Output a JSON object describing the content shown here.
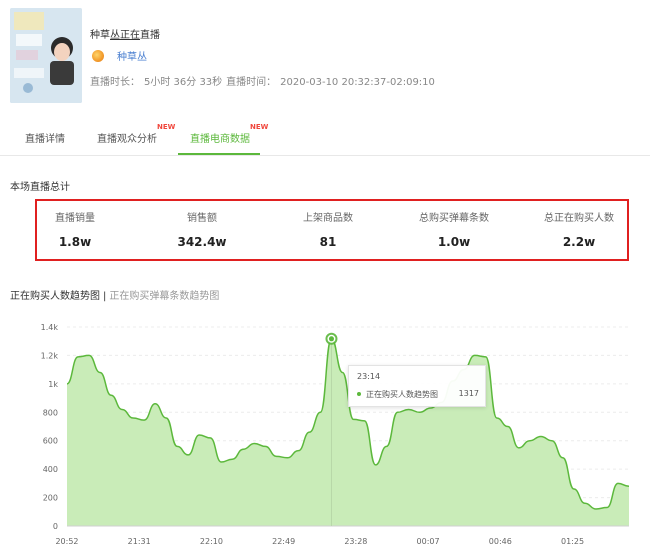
{
  "header": {
    "title_prefix": "种草",
    "title_underlined": "丛正在",
    "title_suffix": "直播",
    "anchor_name": "种草丛",
    "duration_label": "直播时长：",
    "duration_value": "5小时 36分 33秒",
    "time_label": "直播时间：",
    "time_value": "2020-03-10 20:32:37-02:09:10"
  },
  "tabs": [
    {
      "label": "直播详情",
      "new": ""
    },
    {
      "label": "直播观众分析",
      "new": "NEW"
    },
    {
      "label": "直播电商数据",
      "new": "NEW",
      "active": true
    }
  ],
  "summary": {
    "title": "本场直播总计",
    "stats": [
      {
        "label": "直播销量",
        "value": "1.8w"
      },
      {
        "label": "销售额",
        "value": "342.4w"
      },
      {
        "label": "上架商品数",
        "value": "81"
      },
      {
        "label": "总购买弹幕条数",
        "value": "1.0w"
      },
      {
        "label": "总正在购买人数",
        "value": "2.2w"
      }
    ]
  },
  "chart_tabs": {
    "active": "正在购买人数趋势图",
    "separator": "|",
    "inactive": "正在购买弹幕条数趋势图"
  },
  "tooltip": {
    "time": "23:14",
    "series": "正在购买人数趋势图",
    "value": "1317"
  },
  "colors": {
    "accent": "#5cb83c",
    "area_fill": "#c9ecb8",
    "highlight_border": "#e02020",
    "new_badge": "#f0473d"
  },
  "chart_data": {
    "type": "area",
    "title": "正在购买人数趋势图",
    "xlabel": "",
    "ylabel": "",
    "ylim": [
      0,
      1400
    ],
    "yticks": [
      0,
      200,
      400,
      600,
      800,
      1000,
      1200,
      1400
    ],
    "ytick_labels": [
      "0",
      "200",
      "400",
      "600",
      "800",
      "1k",
      "1.2k",
      "1.4k"
    ],
    "xtick_labels": [
      "20:52",
      "21:31",
      "22:10",
      "22:49",
      "23:28",
      "00:07",
      "00:46",
      "01:25"
    ],
    "grid": true,
    "x": [
      "20:52",
      "20:58",
      "21:05",
      "21:10",
      "21:17",
      "21:24",
      "21:31",
      "21:37",
      "21:43",
      "21:49",
      "21:52",
      "21:56",
      "22:02",
      "22:08",
      "22:13",
      "22:20",
      "22:28",
      "22:35",
      "22:42",
      "22:49",
      "22:56",
      "23:03",
      "23:08",
      "23:12",
      "23:14",
      "23:17",
      "23:21",
      "23:25",
      "23:31",
      "23:36",
      "23:42",
      "23:48",
      "23:54",
      "24:00",
      "00:07",
      "00:13",
      "00:20",
      "00:26",
      "00:31",
      "00:36",
      "00:40",
      "00:46",
      "00:53",
      "00:58",
      "01:04",
      "01:10",
      "01:16",
      "01:22",
      "01:29",
      "01:34",
      "01:40",
      "01:48"
    ],
    "series": [
      {
        "values": [
          1000,
          1190,
          1200,
          1080,
          920,
          820,
          760,
          745,
          860,
          760,
          560,
          500,
          640,
          620,
          450,
          470,
          540,
          580,
          560,
          490,
          480,
          530,
          660,
          800,
          1317,
          1080,
          750,
          740,
          430,
          560,
          800,
          820,
          800,
          830,
          870,
          1020,
          1100,
          1200,
          1190,
          760,
          700,
          550,
          600,
          630,
          600,
          480,
          260,
          160,
          120,
          130,
          300,
          280
        ]
      }
    ]
  }
}
